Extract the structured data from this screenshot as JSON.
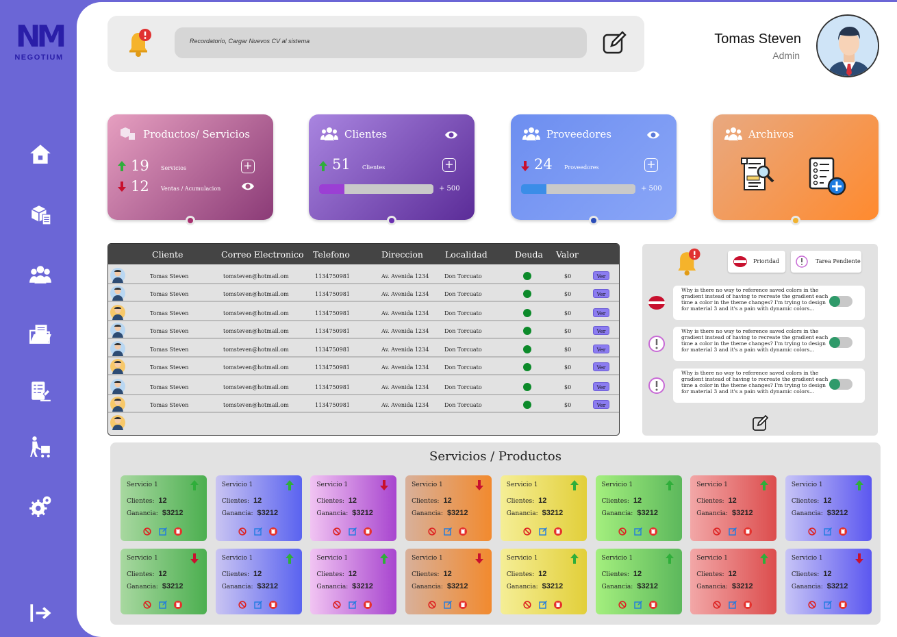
{
  "brand": {
    "mark": "NM",
    "name": "NEGOTIUM"
  },
  "sidebar": {
    "items": [
      "home-icon",
      "boxes-icon",
      "users-icon",
      "folder-icon",
      "report-icon",
      "delivery-icon",
      "settings-icon",
      "logout-icon"
    ]
  },
  "topbar": {
    "reminder": "Recordatorio, Cargar Nuevos CV al sistema"
  },
  "user": {
    "name": "Tomas Steven",
    "role": "Admin"
  },
  "cards": {
    "productos": {
      "title": "Productos/ Servicios",
      "value1": "19",
      "label1": "Servicios",
      "value2": "12",
      "label2": "Ventas / Acumulacion"
    },
    "clientes": {
      "title": "Clientes",
      "value": "51",
      "label": "Clientes",
      "progress_label": "+ 500",
      "progress": 0.22
    },
    "proveedores": {
      "title": "Proveedores",
      "value": "24",
      "label": "Proveedores",
      "progress_label": "+ 500",
      "progress": 0.22
    },
    "archivos": {
      "title": "Archivos"
    }
  },
  "table": {
    "headers": [
      "Cliente",
      "Correo Electronico",
      "Telefono",
      "Direccion",
      "Localidad",
      "Deuda",
      "Valor"
    ],
    "rows": [
      {
        "cliente": "Tomas Steven",
        "correo": "tomsteven@hotmail.om",
        "telefono": "1134750981",
        "direccion": "Av. Avenida 1234",
        "localidad": "Don Torcuato",
        "valor": "$0",
        "accion": "Ver"
      },
      {
        "cliente": "Tomas Steven",
        "correo": "tomsteven@hotmail.om",
        "telefono": "1134750981",
        "direccion": "Av. Avenida 1234",
        "localidad": "Don Torcuato",
        "valor": "$0",
        "accion": "Ver"
      },
      {
        "cliente": "Tomas Steven",
        "correo": "tomsteven@hotmail.om",
        "telefono": "1134750981",
        "direccion": "Av. Avenida 1234",
        "localidad": "Don Torcuato",
        "valor": "$0",
        "accion": "Ver"
      },
      {
        "cliente": "Tomas Steven",
        "correo": "tomsteven@hotmail.om",
        "telefono": "1134750981",
        "direccion": "Av. Avenida 1234",
        "localidad": "Don Torcuato",
        "valor": "$0",
        "accion": "Ver"
      },
      {
        "cliente": "Tomas Steven",
        "correo": "tomsteven@hotmail.om",
        "telefono": "1134750981",
        "direccion": "Av. Avenida 1234",
        "localidad": "Don Torcuato",
        "valor": "$0",
        "accion": "Ver"
      },
      {
        "cliente": "Tomas Steven",
        "correo": "tomsteven@hotmail.om",
        "telefono": "1134750981",
        "direccion": "Av. Avenida 1234",
        "localidad": "Don Torcuato",
        "valor": "$0",
        "accion": "Ver"
      },
      {
        "cliente": "Tomas Steven",
        "correo": "tomsteven@hotmail.om",
        "telefono": "1134750981",
        "direccion": "Av. Avenida 1234",
        "localidad": "Don Torcuato",
        "valor": "$0",
        "accion": "Ver"
      },
      {
        "cliente": "Tomas Steven",
        "correo": "tomsteven@hotmail.om",
        "telefono": "1134750981",
        "direccion": "Av. Avenida 1234",
        "localidad": "Don Torcuato",
        "valor": "$0",
        "accion": "Ver"
      }
    ]
  },
  "notes": {
    "chip_priority": "Prioridad",
    "chip_pending": "Tarea Pendiente",
    "items": [
      {
        "text": "Why is there no way to reference saved colors in the gradient instead of having to recreate the gradient each time a color in the theme changes? I'm trying to design for material 3 and it's a pain with dynamic colors...",
        "type": "priority"
      },
      {
        "text": "Why is there no way to reference saved colors in the gradient instead of having to recreate the gradient each time a color in the theme changes? I'm trying to design for material 3 and it's a pain with dynamic colors...",
        "type": "pending"
      },
      {
        "text": "Why is there no way to reference saved colors in the gradient instead of having to recreate the gradient each time a color in the theme changes? I'm trying to design for material 3 and it's a pain with dynamic colors...",
        "type": "pending"
      }
    ]
  },
  "services": {
    "title": "Servicios / Productos",
    "clients_label": "Clientes:",
    "gain_label": "Ganancia:",
    "items": [
      {
        "name": "Servicio 1",
        "clientes": "12",
        "ganancia": "$3212",
        "trend": "up"
      },
      {
        "name": "Servicio 1",
        "clientes": "12",
        "ganancia": "$3212",
        "trend": "up"
      },
      {
        "name": "Servicio 1",
        "clientes": "12",
        "ganancia": "$3212",
        "trend": "down"
      },
      {
        "name": "Servicio 1",
        "clientes": "12",
        "ganancia": "$3212",
        "trend": "down"
      },
      {
        "name": "Servicio 1",
        "clientes": "12",
        "ganancia": "$3212",
        "trend": "up"
      },
      {
        "name": "Servicio 1",
        "clientes": "12",
        "ganancia": "$3212",
        "trend": "up"
      },
      {
        "name": "Servicio 1",
        "clientes": "12",
        "ganancia": "$3212",
        "trend": "up"
      },
      {
        "name": "Servicio 1",
        "clientes": "12",
        "ganancia": "$3212",
        "trend": "up"
      },
      {
        "name": "Servicio 1",
        "clientes": "12",
        "ganancia": "$3212",
        "trend": "down"
      },
      {
        "name": "Servicio 1",
        "clientes": "12",
        "ganancia": "$3212",
        "trend": "up"
      },
      {
        "name": "Servicio 1",
        "clientes": "12",
        "ganancia": "$3212",
        "trend": "up"
      },
      {
        "name": "Servicio 1",
        "clientes": "12",
        "ganancia": "$3212",
        "trend": "down"
      },
      {
        "name": "Servicio 1",
        "clientes": "12",
        "ganancia": "$3212",
        "trend": "up"
      },
      {
        "name": "Servicio 1",
        "clientes": "12",
        "ganancia": "$3212",
        "trend": "up"
      },
      {
        "name": "Servicio 1",
        "clientes": "12",
        "ganancia": "$3212",
        "trend": "up"
      },
      {
        "name": "Servicio 1",
        "clientes": "12",
        "ganancia": "$3212",
        "trend": "down"
      }
    ]
  },
  "colors": {
    "sidebar": "#6b66d6",
    "up": "#2fae3a",
    "down": "#c8102e",
    "debt_ok": "#0c8a2a"
  }
}
